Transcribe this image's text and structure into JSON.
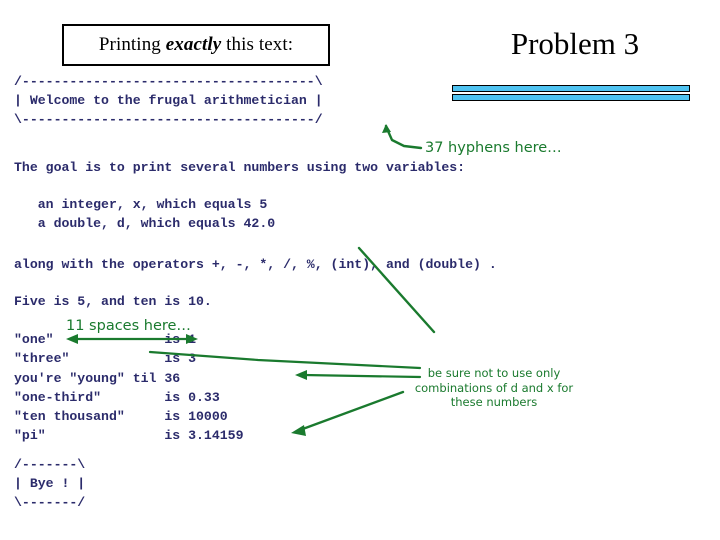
{
  "slide": {
    "title_prefix": "Printing ",
    "title_emphasis": "exactly",
    "title_suffix": " this text:",
    "heading": "Problem 3",
    "accent_color": "#4fc3f1",
    "code_color": "#2b2b6b",
    "annotation_color": "#1a7a2e"
  },
  "output": {
    "banner": "/-----------------------------\\\n| Welcome to the frugal arithmetician |\n\\-----------------------------/",
    "banner_top": "/-------------------------------------\\",
    "banner_middle": "| Welcome to the frugal arithmetician |",
    "banner_bottom": "\\-------------------------------------/",
    "goal_line": "The goal is to print several numbers using two variables:",
    "var_int": "   an integer, x, which equals 5",
    "var_double": "   a double, d, which equals 42.0",
    "operators_line": "along with the operators +, -, *, /, %, (int), and (double) .",
    "five_line": "Five is 5, and ten is 10.",
    "table": [
      "\"one\"              is 1",
      "\"three\"            is 3",
      "you're \"young\" til 36",
      "\"one-third\"        is 0.33",
      "\"ten thousand\"     is 10000",
      "\"pi\"               is 3.14159"
    ],
    "closing_top": "/-------\\",
    "closing_middle": "| Bye ! |",
    "closing_bottom": "\\-------/"
  },
  "annotations": {
    "hyphens_note": "37 hyphens here…",
    "spaces_note": "11 spaces here…",
    "numbers_note": "be sure not to use only combinations of d and x for these numbers"
  }
}
